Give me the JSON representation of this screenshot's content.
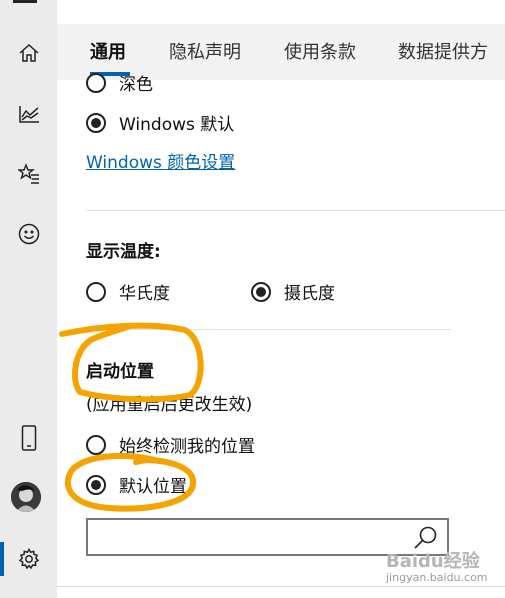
{
  "nav": {
    "items": [
      {
        "name": "home-icon"
      },
      {
        "name": "chart-icon"
      },
      {
        "name": "star-list-icon"
      },
      {
        "name": "smiley-icon"
      },
      {
        "name": "phone-icon"
      },
      {
        "name": "avatar"
      },
      {
        "name": "gear-icon"
      }
    ],
    "selected": "gear-icon",
    "accent": "#0063b1"
  },
  "tabs": [
    {
      "label": "通用",
      "active": true
    },
    {
      "label": "隐私声明",
      "active": false
    },
    {
      "label": "使用条款",
      "active": false
    },
    {
      "label": "数据提供方",
      "active": false
    }
  ],
  "theme": {
    "partial_option": "深色",
    "windows_default": "Windows 默认",
    "selected": "Windows 默认",
    "color_link": "Windows 颜色设置"
  },
  "temperature": {
    "heading": "显示温度:",
    "fahrenheit": "华氏度",
    "celsius": "摄氏度",
    "selected": "摄氏度"
  },
  "launch": {
    "heading": "启动位置",
    "note": "(应用重启后更改生效)",
    "detect": "始终检测我的位置",
    "default": "默认位置",
    "selected": "默认位置",
    "search_value": "",
    "search_icon": "search-icon"
  },
  "annotation_color": "#f5a300",
  "watermark": {
    "line1": "Baidu经验",
    "line2": "jingyan.baidu.com"
  }
}
